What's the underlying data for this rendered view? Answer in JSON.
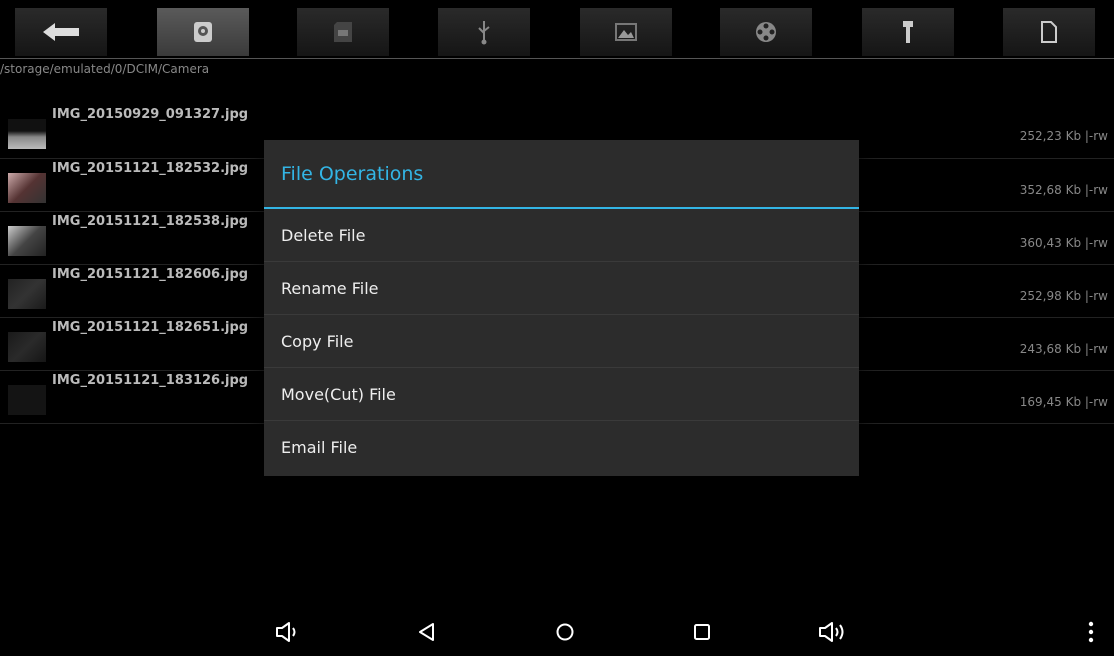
{
  "path": "/storage/emulated/0/DCIM/Camera",
  "toolbar": {
    "tabs": [
      {
        "icon": "back-arrow-icon"
      },
      {
        "icon": "internal-storage-icon",
        "active": true
      },
      {
        "icon": "sd-card-icon"
      },
      {
        "icon": "usb-icon"
      },
      {
        "icon": "pictures-icon"
      },
      {
        "icon": "video-reel-icon"
      },
      {
        "icon": "tools-icon"
      },
      {
        "icon": "document-icon"
      }
    ]
  },
  "files": [
    {
      "name": "IMG_20150929_091327.jpg",
      "meta": "252,23 Kb  |-rw"
    },
    {
      "name": "IMG_20151121_182532.jpg",
      "meta": "352,68 Kb  |-rw"
    },
    {
      "name": "IMG_20151121_182538.jpg",
      "meta": "360,43 Kb  |-rw"
    },
    {
      "name": "IMG_20151121_182606.jpg",
      "meta": "252,98 Kb  |-rw"
    },
    {
      "name": "IMG_20151121_182651.jpg",
      "meta": "243,68 Kb  |-rw"
    },
    {
      "name": "IMG_20151121_183126.jpg",
      "meta": "169,45 Kb  |-rw"
    }
  ],
  "dialog": {
    "title": "File Operations",
    "items": [
      "Delete File",
      "Rename File",
      "Copy File",
      "Move(Cut) File",
      "Email File"
    ]
  },
  "navbar": {
    "buttons": [
      "volume-down-icon",
      "back-icon",
      "home-icon",
      "recents-icon",
      "volume-up-icon",
      "overflow-menu-icon"
    ]
  },
  "colors": {
    "accent": "#33b5e5",
    "background": "#000000",
    "dialog": "#2c2c2c"
  }
}
